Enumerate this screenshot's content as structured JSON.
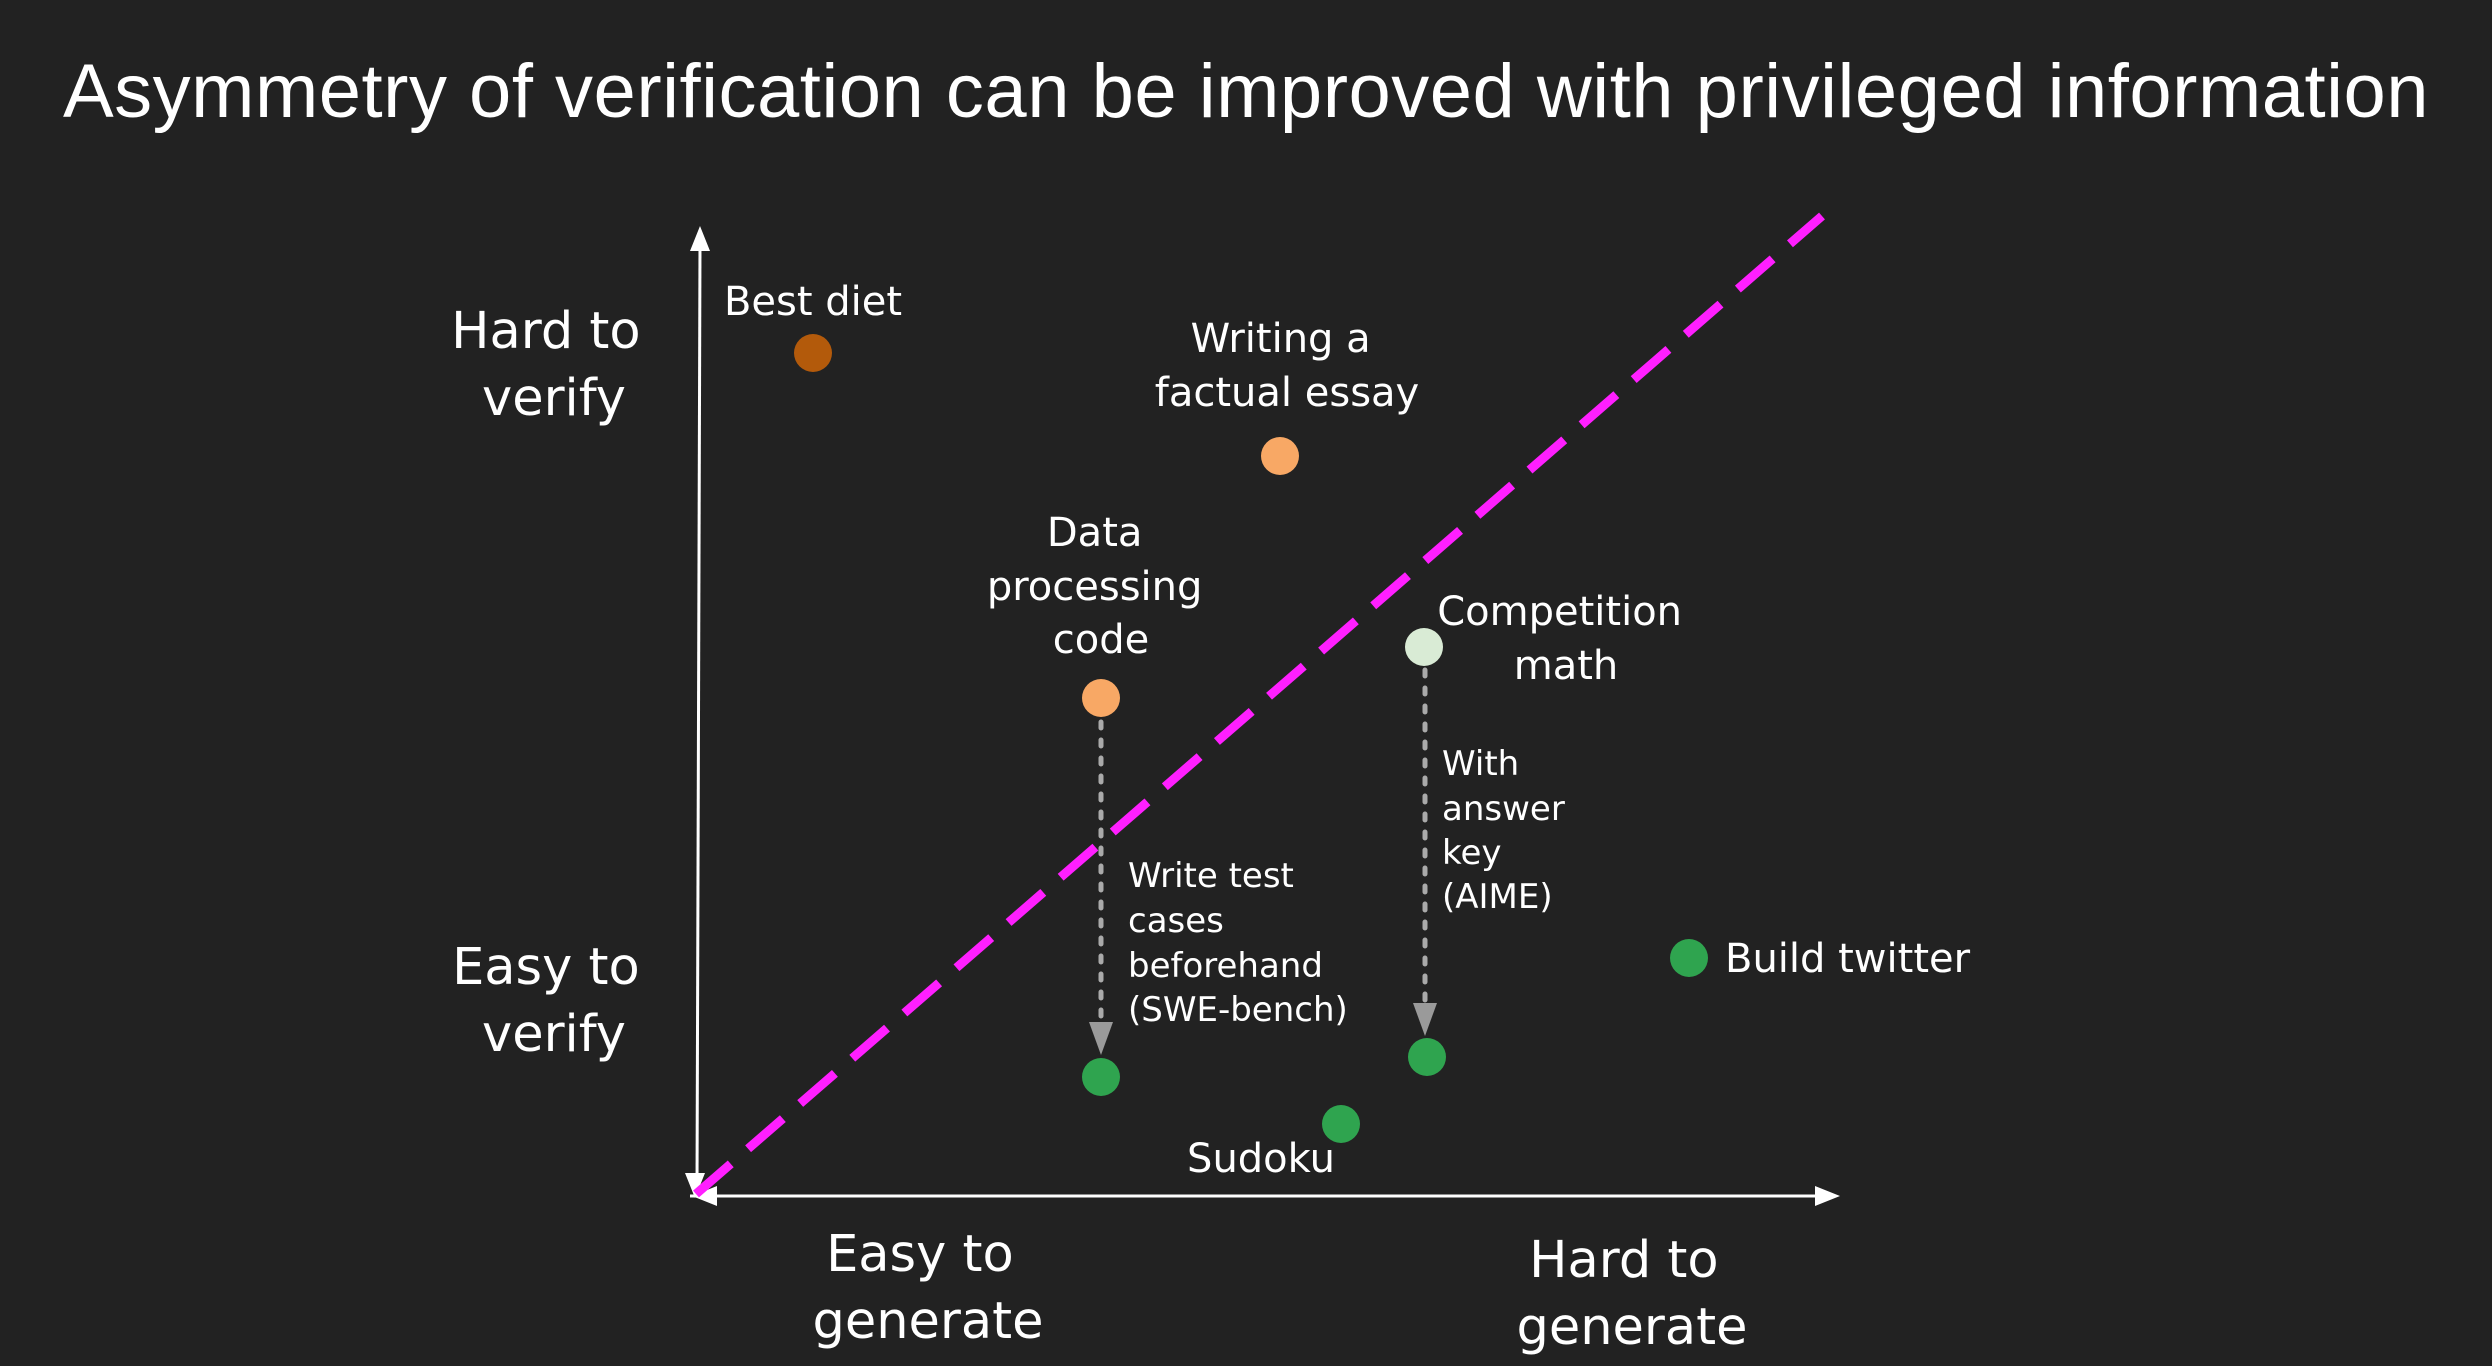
{
  "title": "Asymmetry of verification can be improved with privileged information",
  "axes": {
    "y_top": [
      "Hard to",
      "verify"
    ],
    "y_bottom": [
      "Easy to",
      "verify"
    ],
    "x_left": [
      "Easy to",
      "generate"
    ],
    "x_right": [
      "Hard to",
      "generate"
    ]
  },
  "points": {
    "best_diet": {
      "label": [
        "Best diet"
      ],
      "color": "#b35a0b"
    },
    "factual_essay": {
      "label": [
        "Writing a",
        "factual essay"
      ],
      "color": "#f8a865"
    },
    "data_processing": {
      "label": [
        "Data",
        "processing",
        "code"
      ],
      "color": "#f8a865"
    },
    "competition_math": {
      "label": [
        "Competition",
        "math"
      ],
      "color": "#d9ebd5"
    },
    "data_processing_verified": {
      "label": [],
      "color": "#2fa44f"
    },
    "competition_math_verified": {
      "label": [],
      "color": "#2fa44f"
    },
    "sudoku": {
      "label": [
        "Sudoku"
      ],
      "color": "#2fa44f"
    },
    "build_twitter": {
      "label": [
        "Build twitter"
      ],
      "color": "#2fa44f"
    }
  },
  "arrows": {
    "test_cases": {
      "label": [
        "Write test",
        "cases",
        "beforehand",
        "(SWE-bench)"
      ]
    },
    "answer_key": {
      "label": [
        "With",
        "answer",
        "key",
        "(AIME)"
      ]
    }
  },
  "colors": {
    "background": "#222222",
    "diagonal": "#ff1fff",
    "axis": "#ffffff",
    "dotted_arrow": "#aaaaaa",
    "arrow_head": "#9a9a9a"
  }
}
